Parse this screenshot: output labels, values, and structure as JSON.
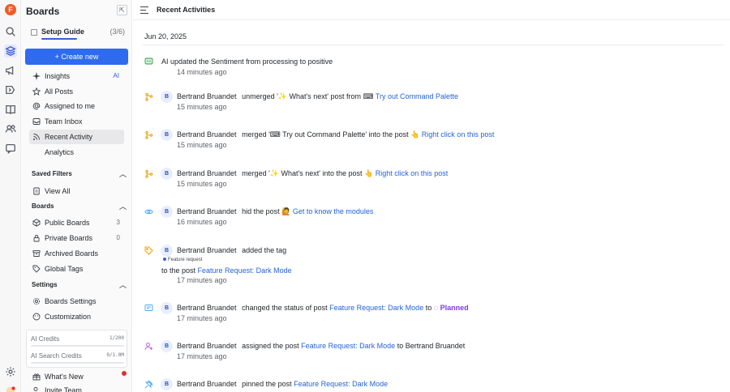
{
  "app": {
    "logo_letter": "F"
  },
  "rail": {
    "icons": [
      "search-icon",
      "layers-icon",
      "megaphone-icon",
      "roadmap-icon",
      "book-icon",
      "users-icon",
      "chat-icon",
      "settings-icon",
      "avatar-icon"
    ]
  },
  "sidebar": {
    "title": "Boards",
    "setup_guide": {
      "label": "Setup Guide",
      "count": "(3/6)"
    },
    "create_label": "+ Create new",
    "items": [
      {
        "label": "Insights",
        "badge": "AI"
      },
      {
        "label": "All Posts"
      },
      {
        "label": "Assigned to me"
      },
      {
        "label": "Team Inbox"
      },
      {
        "label": "Recent Activity"
      },
      {
        "label": "Analytics"
      }
    ],
    "saved_filters": {
      "title": "Saved Filters",
      "items": [
        {
          "label": "View All"
        }
      ]
    },
    "boards": {
      "title": "Boards",
      "items": [
        {
          "label": "Public Boards",
          "count": "3"
        },
        {
          "label": "Private Boards",
          "count": "0"
        },
        {
          "label": "Archived Boards"
        },
        {
          "label": "Global Tags"
        }
      ]
    },
    "settings": {
      "title": "Settings",
      "items": [
        {
          "label": "Boards Settings"
        },
        {
          "label": "Customization"
        }
      ]
    },
    "credits": {
      "ai": {
        "label": "AI Credits",
        "value": "1/200",
        "fraction": 0.005
      },
      "search": {
        "label": "AI Search Credits",
        "value": "0/1.0M",
        "fraction": 0
      }
    },
    "bottom": [
      {
        "label": "What's New"
      },
      {
        "label": "Invite Team"
      }
    ]
  },
  "header": {
    "title": "Recent Activities"
  },
  "feed": {
    "date": "Jun 20, 2025",
    "activities": [
      {
        "kind_icon": "ai-icon",
        "avatar": "",
        "user": "",
        "verb": "AI updated the Sentiment from processing to positive",
        "target": "",
        "time": "14 minutes ago"
      },
      {
        "kind_icon": "unmerge-icon",
        "avatar": "B",
        "user": "Bertrand Bruandet",
        "verb": "unmerged '✨ What's next' post from ⌨ ",
        "target": "Try out Command Palette",
        "time": "15 minutes ago"
      },
      {
        "kind_icon": "merge-icon",
        "avatar": "B",
        "user": "Bertrand Bruandet",
        "verb": "merged '⌨ Try out Command Palette' into the post 👆 ",
        "target": "Right click on this post",
        "time": "15 minutes ago"
      },
      {
        "kind_icon": "merge-icon",
        "avatar": "B",
        "user": "Bertrand Bruandet",
        "verb": "merged '✨ What's next' into the post 👆 ",
        "target": "Right click on this post",
        "time": "15 minutes ago"
      },
      {
        "kind_icon": "eye-icon",
        "avatar": "B",
        "user": "Bertrand Bruandet",
        "verb": "hid the post 🙋 ",
        "target": "Get to know the modules",
        "time": "16 minutes ago"
      },
      {
        "kind_icon": "tag-icon",
        "avatar": "B",
        "user": "Bertrand Bruandet",
        "verb": "added the tag",
        "tag": "Feature request",
        "prefix": "to the post ",
        "target": "Feature Request: Dark Mode",
        "time": "17 minutes ago"
      },
      {
        "kind_icon": "status-icon",
        "avatar": "B",
        "user": "Bertrand Bruandet",
        "verb": "changed the status of post ",
        "target": "Feature Request: Dark Mode",
        "suffix": " to ",
        "status": "◌ Planned",
        "time": "17 minutes ago"
      },
      {
        "kind_icon": "assign-icon",
        "avatar": "B",
        "user": "Bertrand Bruandet",
        "verb": "assigned the post ",
        "target": "Feature Request: Dark Mode",
        "suffix": " to Bertrand Bruandet",
        "time": "17 minutes ago"
      },
      {
        "kind_icon": "pin-icon",
        "avatar": "B",
        "user": "Bertrand Bruandet",
        "verb": "pinned the post ",
        "target": "Feature Request: Dark Mode",
        "time": ""
      }
    ]
  },
  "colors": {
    "accent": "#2f6bed",
    "link": "#2563d6",
    "planned": "#7c3aed",
    "logo": "#f15a24"
  }
}
